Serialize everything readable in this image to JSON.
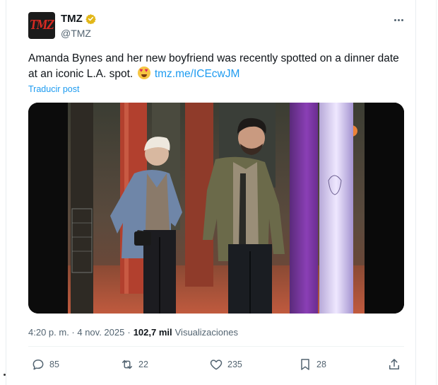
{
  "post": {
    "display_name": "TMZ",
    "handle": "@TMZ",
    "avatar_logo": "TMZ",
    "text": "Amanda Bynes and her new boyfriend was recently spotted on a dinner date at an iconic L.A. spot.",
    "link": "tmz.me/ICEcwJM",
    "translate_label": "Traducir post",
    "timestamp": "4:20 p. m. · 4 nov. 2025",
    "separator": "·",
    "views_count": "102,7 mil",
    "views_label": "Visualizaciones"
  },
  "actions": {
    "replies": "85",
    "reposts": "22",
    "likes": "235",
    "bookmarks": "28"
  },
  "icons": {
    "verified": "verified-badge-icon",
    "more": "more-options-icon",
    "reply": "reply-icon",
    "repost": "repost-icon",
    "like": "heart-icon",
    "bookmark": "bookmark-icon",
    "share": "share-icon",
    "emoji": "heart-eyes-emoji"
  },
  "colors": {
    "accent": "#1d9bf0",
    "verified_gold": "#e2b719",
    "muted": "#536471",
    "text": "#0f1419"
  }
}
